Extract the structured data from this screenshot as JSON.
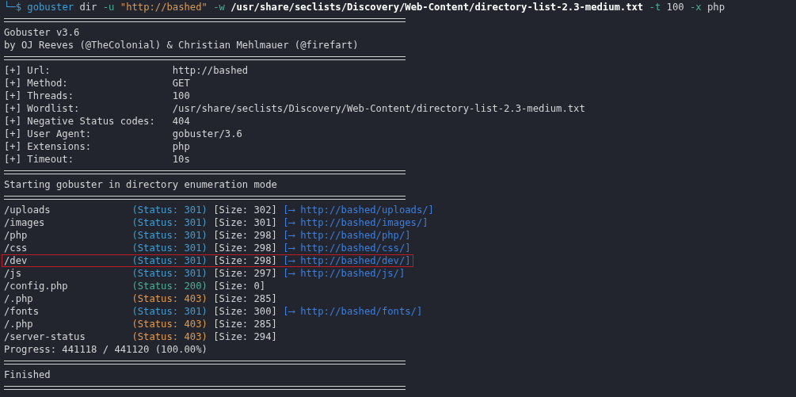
{
  "prompt": {
    "symbol": "└─$",
    "tokens": [
      {
        "kind": "program",
        "text": "gobuster"
      },
      {
        "kind": "plain",
        "text": "dir"
      },
      {
        "kind": "flag",
        "text": "-u"
      },
      {
        "kind": "string",
        "text": "\"http://bashed\""
      },
      {
        "kind": "flag",
        "text": "-w"
      },
      {
        "kind": "path",
        "text": "/usr/share/seclists/Discovery/Web-Content/directory-list-2.3-medium.txt"
      },
      {
        "kind": "flag",
        "text": "-t"
      },
      {
        "kind": "plain",
        "text": "100"
      },
      {
        "kind": "flag",
        "text": "-x"
      },
      {
        "kind": "plain",
        "text": "php"
      }
    ]
  },
  "banner": [
    "Gobuster v3.6",
    "by OJ Reeves (@TheColonial) & Christian Mehlmauer (@firefart)"
  ],
  "config": [
    {
      "label": "[+] Url:",
      "value": "http://bashed"
    },
    {
      "label": "[+] Method:",
      "value": "GET"
    },
    {
      "label": "[+] Threads:",
      "value": "100"
    },
    {
      "label": "[+] Wordlist:",
      "value": "/usr/share/seclists/Discovery/Web-Content/directory-list-2.3-medium.txt"
    },
    {
      "label": "[+] Negative Status codes:",
      "value": "404"
    },
    {
      "label": "[+] User Agent:",
      "value": "gobuster/3.6"
    },
    {
      "label": "[+] Extensions:",
      "value": "php"
    },
    {
      "label": "[+] Timeout:",
      "value": "10s"
    }
  ],
  "start_message": "Starting gobuster in directory enumeration mode",
  "results": [
    {
      "path": "/uploads",
      "status": "(Status: 301)",
      "color": "#3e9fd6",
      "size": "[Size: 302]",
      "redirect": "[⟶ http://bashed/uploads/]",
      "highlighted": false
    },
    {
      "path": "/images",
      "status": "(Status: 301)",
      "color": "#3e9fd6",
      "size": "[Size: 301]",
      "redirect": "[⟶ http://bashed/images/]",
      "highlighted": false
    },
    {
      "path": "/php",
      "status": "(Status: 301)",
      "color": "#3e9fd6",
      "size": "[Size: 298]",
      "redirect": "[⟶ http://bashed/php/]",
      "highlighted": false
    },
    {
      "path": "/css",
      "status": "(Status: 301)",
      "color": "#3e9fd6",
      "size": "[Size: 298]",
      "redirect": "[⟶ http://bashed/css/]",
      "highlighted": false
    },
    {
      "path": "/dev",
      "status": "(Status: 301)",
      "color": "#3e9fd6",
      "size": "[Size: 298]",
      "redirect": "[⟶ http://bashed/dev/]",
      "highlighted": true
    },
    {
      "path": "/js",
      "status": "(Status: 301)",
      "color": "#3e9fd6",
      "size": "[Size: 297]",
      "redirect": "[⟶ http://bashed/js/]",
      "highlighted": false
    },
    {
      "path": "/config.php",
      "status": "(Status: 200)",
      "color": "#4caf93",
      "size": "[Size: 0]",
      "highlighted": false
    },
    {
      "path": "/.php",
      "status": "(Status: 403)",
      "color": "#e59a48",
      "size": "[Size: 285]",
      "highlighted": false
    },
    {
      "path": "/fonts",
      "status": "(Status: 301)",
      "color": "#3e9fd6",
      "size": "[Size: 300]",
      "redirect": "[⟶ http://bashed/fonts/]",
      "highlighted": false
    },
    {
      "path": "/.php",
      "status": "(Status: 403)",
      "color": "#e59a48",
      "size": "[Size: 285]",
      "highlighted": false
    },
    {
      "path": "/server-status",
      "status": "(Status: 403)",
      "color": "#e59a48",
      "size": "[Size: 294]",
      "highlighted": false
    }
  ],
  "progress": "Progress: 441118 / 441120 (100.00%)",
  "finish_message": "Finished"
}
